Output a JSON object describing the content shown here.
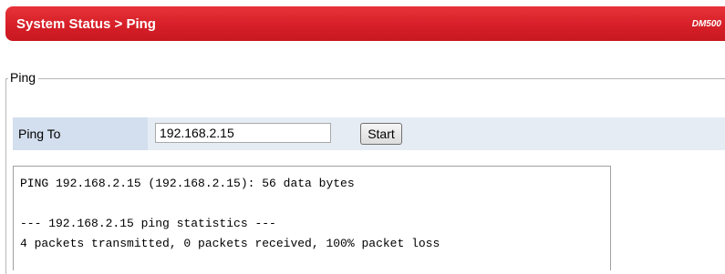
{
  "header": {
    "breadcrumb": "System Status > Ping",
    "model": "DM500"
  },
  "section": {
    "legend": "Ping"
  },
  "form": {
    "ping_to_label": "Ping To",
    "ip_value": "192.168.2.15",
    "start_label": "Start"
  },
  "output": {
    "lines": [
      "PING 192.168.2.15 (192.168.2.15): 56 data bytes",
      "",
      "--- 192.168.2.15 ping statistics ---",
      "4 packets transmitted, 0 packets received, 100% packet loss"
    ]
  },
  "colors": {
    "header_red": "#d61f28",
    "label_cell": "#d3dfee",
    "row_background": "#e6ecf4"
  }
}
